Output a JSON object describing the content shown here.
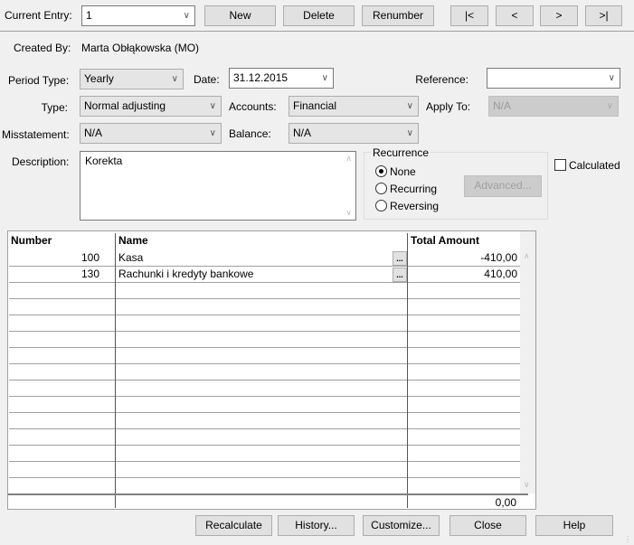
{
  "toolbar": {
    "current_entry_label": "Current Entry:",
    "current_entry_value": "1",
    "new": "New",
    "delete": "Delete",
    "renumber": "Renumber",
    "first": "|<",
    "prev": "<",
    "next": ">",
    "last": ">|"
  },
  "form": {
    "created_by_label": "Created By:",
    "created_by_value": "Marta Obłąkowska (MO)",
    "period_type_label": "Period Type:",
    "period_type_value": "Yearly",
    "date_label": "Date:",
    "date_value": "31.12.2015",
    "reference_label": "Reference:",
    "reference_value": "",
    "type_label": "Type:",
    "type_value": "Normal adjusting",
    "accounts_label": "Accounts:",
    "accounts_value": "Financial",
    "apply_to_label": "Apply To:",
    "apply_to_value": "N/A",
    "misstatement_label": "Misstatement:",
    "misstatement_value": "N/A",
    "balance_label": "Balance:",
    "balance_value": "N/A",
    "description_label": "Description:",
    "description_value": "Korekta",
    "recurrence": {
      "title": "Recurrence",
      "options": [
        "None",
        "Recurring",
        "Reversing"
      ],
      "selected": "None",
      "advanced": "Advanced..."
    },
    "calculated_label": "Calculated",
    "calculated_checked": false
  },
  "grid": {
    "columns": [
      "Number",
      "Name",
      "Total Amount"
    ],
    "rows": [
      {
        "number": "100",
        "name": "Kasa",
        "amount": "-410,00"
      },
      {
        "number": "130",
        "name": "Rachunki i kredyty bankowe",
        "amount": "410,00"
      }
    ],
    "total": "0,00",
    "ellipsis": "..."
  },
  "footer": {
    "recalculate": "Recalculate",
    "history": "History...",
    "customize": "Customize...",
    "close": "Close",
    "help": "Help"
  }
}
